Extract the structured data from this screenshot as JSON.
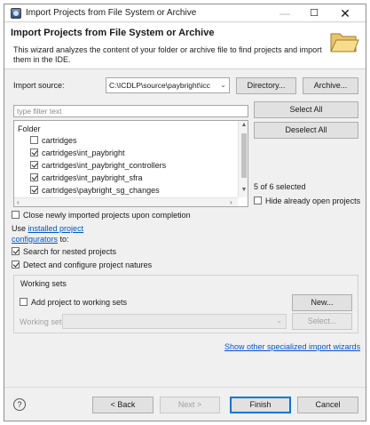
{
  "window": {
    "title": "Import Projects from File System or Archive"
  },
  "header": {
    "title": "Import Projects from File System or Archive",
    "description": "This wizard analyzes the content of your folder or archive file to find projects and import them in the IDE."
  },
  "import_source": {
    "label": "Import source:",
    "value": "C:\\ICDLP\\source\\paybright\\icc",
    "directory_button": "Directory...",
    "archive_button": "Archive..."
  },
  "filter": {
    "placeholder": "type filter text"
  },
  "tree": {
    "header": "Folder",
    "items": [
      {
        "label": "cartridges",
        "checked": false
      },
      {
        "label": "cartridges\\int_paybright",
        "checked": true
      },
      {
        "label": "cartridges\\int_paybright_controllers",
        "checked": true
      },
      {
        "label": "cartridges\\int_paybright_sfra",
        "checked": true
      },
      {
        "label": "cartridges\\paybright_sg_changes",
        "checked": true
      }
    ]
  },
  "side": {
    "select_all": "Select All",
    "deselect_all": "Deselect All",
    "selected_count": "5 of 6 selected",
    "hide_open": "Hide already open projects"
  },
  "options": {
    "close_imported": "Close newly imported projects upon completion",
    "use_prefix": "Use",
    "installed_link_1": "installed project",
    "installed_link_2": "configurators",
    "to_suffix": "to:",
    "search_nested": "Search for nested projects",
    "detect_natures": "Detect and configure project natures"
  },
  "working_sets": {
    "group_title": "Working sets",
    "add_label": "Add project to working sets",
    "new_button": "New...",
    "sets_label": "Working sets:",
    "select_button": "Select..."
  },
  "show_other_link": "Show other specialized import wizards",
  "footer": {
    "help": "?",
    "back": "< Back",
    "next": "Next >",
    "finish": "Finish",
    "cancel": "Cancel"
  }
}
